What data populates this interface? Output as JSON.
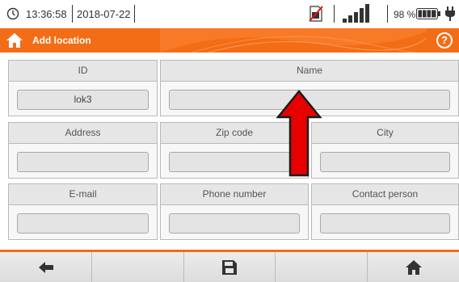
{
  "status_bar": {
    "time": "13:36:58",
    "date": "2018-07-22",
    "battery_percent": "98 %",
    "icons": [
      "clock-icon",
      "no-sim-icon",
      "signal-icon",
      "battery-icon",
      "plug-icon"
    ]
  },
  "title_bar": {
    "title": "Add location",
    "help_label": "?",
    "accent_color": "#f36d16"
  },
  "form": {
    "id": {
      "label": "ID",
      "value": "lok3"
    },
    "name": {
      "label": "Name",
      "value": ""
    },
    "address": {
      "label": "Address",
      "value": ""
    },
    "zip_code": {
      "label": "Zip code",
      "value": ""
    },
    "city": {
      "label": "City",
      "value": ""
    },
    "email": {
      "label": "E-mail",
      "value": ""
    },
    "phone": {
      "label": "Phone number",
      "value": ""
    },
    "contact": {
      "label": "Contact person",
      "value": ""
    }
  },
  "toolbar": {
    "buttons": [
      "back-icon",
      "",
      "save-icon",
      "",
      "home-icon"
    ]
  }
}
